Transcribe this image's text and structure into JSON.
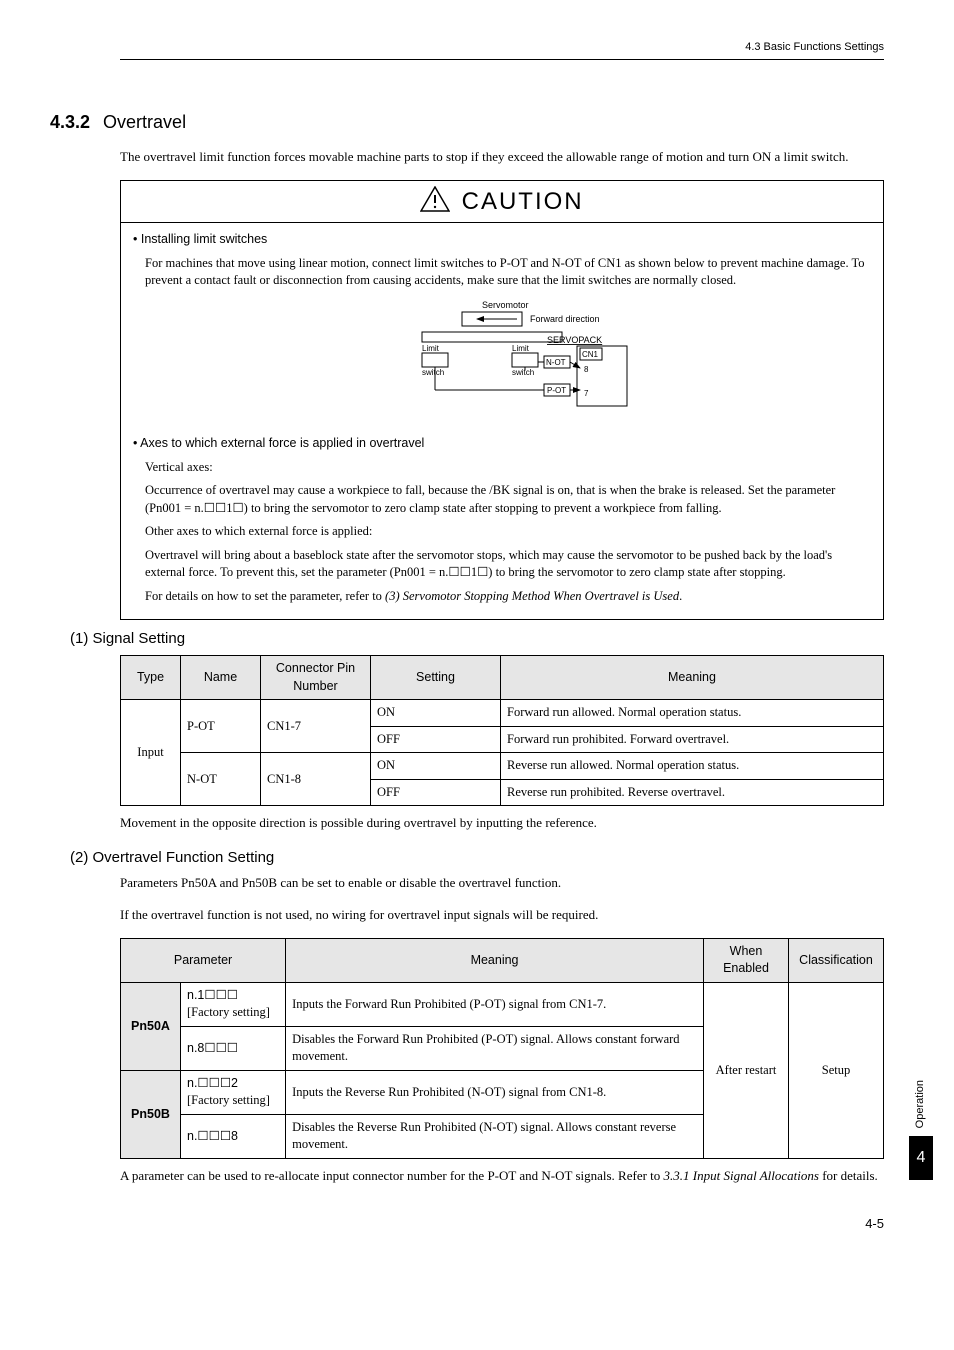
{
  "header": {
    "crumb": "4.3  Basic Functions Settings"
  },
  "section": {
    "number": "4.3.2",
    "title": "Overtravel",
    "intro": "The overtravel limit function forces movable machine parts to stop if they exceed the allowable range of motion and turn ON a limit switch."
  },
  "caution": {
    "label": "CAUTION",
    "b1_head": "•  Installing limit switches",
    "b1_text": "For machines that move using linear motion, connect limit switches to P-OT and N-OT of CN1 as shown below to prevent machine damage. To prevent a contact fault or disconnection from causing accidents, make sure that the limit switches are normally closed.",
    "diagram": {
      "servo": "Servomotor",
      "fwd": "Forward direction",
      "spack": "SERVOPACK",
      "limsw": "Limit switch",
      "cn1": "CN1",
      "not": "N-OT",
      "pot": "P-OT",
      "pin8": "8",
      "pin7": "7"
    },
    "b2_head": "•  Axes to which external force is applied in overtravel",
    "b2_sub": "Vertical axes:",
    "b2_p1": "Occurrence of overtravel may cause a workpiece to fall, because the /BK signal is on, that is when the brake is released. Set the parameter (Pn001 = n.☐☐1☐) to bring the servomotor to zero clamp state after stopping to prevent a workpiece from falling.",
    "b2_p2": "Other axes to which external force is applied:",
    "b2_p3": "Overtravel will bring about a baseblock state after the servomotor stops, which may cause the servomotor to be pushed back by the load's external force. To prevent this, set the parameter (Pn001 = n.☐☐1☐) to bring the servomotor to zero clamp state after stopping.",
    "b2_p4a": "For details on how to set the parameter, refer to ",
    "b2_p4b": "(3) Servomotor Stopping Method When Overtravel is Used"
  },
  "sig": {
    "title": "(1)  Signal Setting",
    "headers": {
      "type": "Type",
      "name": "Name",
      "pin": "Connector Pin Number",
      "setting": "Setting",
      "meaning": "Meaning"
    },
    "rows": {
      "type": "Input",
      "pot_name": "P-OT",
      "pot_pin": "CN1-7",
      "pot_on_s": "ON",
      "pot_on_m": "Forward run allowed. Normal operation status.",
      "pot_off_s": "OFF",
      "pot_off_m": "Forward run prohibited. Forward overtravel.",
      "not_name": "N-OT",
      "not_pin": "CN1-8",
      "not_on_s": "ON",
      "not_on_m": "Reverse run allowed. Normal operation status.",
      "not_off_s": "OFF",
      "not_off_m": "Reverse run prohibited. Reverse overtravel."
    },
    "note": "Movement in the opposite direction is possible during overtravel by inputting the reference."
  },
  "otf": {
    "title": "(2)  Overtravel Function Setting",
    "p1": "Parameters Pn50A and Pn50B can be set to enable or disable the overtravel function.",
    "p2": "If the overtravel function is not used, no wiring for overtravel input signals will be required.",
    "headers": {
      "param": "Parameter",
      "meaning": "Meaning",
      "when": "When Enabled",
      "class": "Classification"
    },
    "rows": {
      "pn50a": "Pn50A",
      "a1_v": "n.1☐☐☐",
      "a1_f": "[Factory setting]",
      "a1_m": "Inputs the Forward Run Prohibited (P-OT) signal from CN1-7.",
      "a2_v": "n.8☐☐☐",
      "a2_m": "Disables the Forward Run Prohibited (P-OT) signal. Allows constant forward movement.",
      "pn50b": "Pn50B",
      "b1_v": "n.☐☐☐2",
      "b1_f": "[Factory setting]",
      "b1_m": "Inputs the Reverse Run Prohibited (N-OT) signal from CN1-8.",
      "b2_v": "n.☐☐☐8",
      "b2_m": "Disables the Reverse Run Prohibited (N-OT) signal. Allows constant reverse movement.",
      "when": "After restart",
      "class": "Setup"
    },
    "note_a": "A parameter can be used to re-allocate input connector number for the P-OT and N-OT signals. Refer to ",
    "note_b": "3.3.1 Input Signal Allocations",
    "note_c": " for details."
  },
  "side": {
    "label": "Operation",
    "chapter": "4"
  },
  "page": "4-5"
}
